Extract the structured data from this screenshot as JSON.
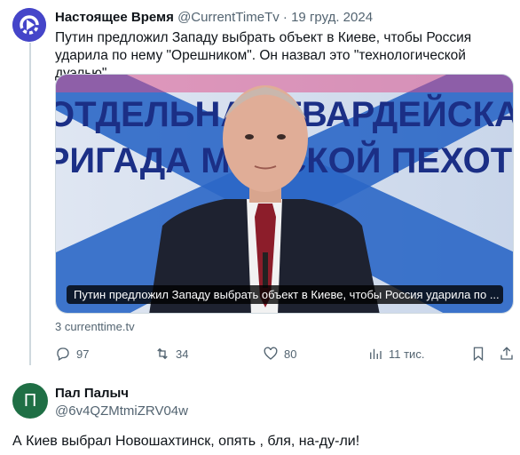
{
  "tweet": {
    "author_name": "Настоящее Время",
    "handle": "@CurrentTimeTv",
    "separator": "·",
    "date": "19 груд. 2024",
    "text": "Путин предложил Западу выбрать объект в Киеве, чтобы Россия ударила по нему \"Орешником\". Он назвал это \"технологической дуэлью\"",
    "media": {
      "caption": "Путин предложил Западу выбрать объект в Киеве, чтобы Россия ударила по ...",
      "banner_line1": "ОТДЕЛЬНАЯ ГВАРДЕЙСКАЯ",
      "banner_line2": "БРИГАДА МОРСКОЙ ПЕХОТЫ"
    },
    "link_source": "3 currenttime.tv",
    "stats": {
      "replies": "97",
      "retweets": "34",
      "likes": "80",
      "views": "11 тис."
    }
  },
  "reply": {
    "avatar_letter": "П",
    "author_name": "Пал Палыч",
    "handle": "@6v4QZMtmiZRV04w",
    "text": "А Киев выбрал Новошахтинск, опять , бля, на-ду-ли!"
  },
  "colors": {
    "brand_avatar": "#3b3fb8",
    "reply_avatar": "#1f6f45",
    "secondary_text": "#536471",
    "thread_line": "#cfd9de"
  },
  "icons": [
    "current-time-logo",
    "reply-icon",
    "retweet-icon",
    "like-icon",
    "views-icon",
    "bookmark-icon",
    "share-icon"
  ]
}
